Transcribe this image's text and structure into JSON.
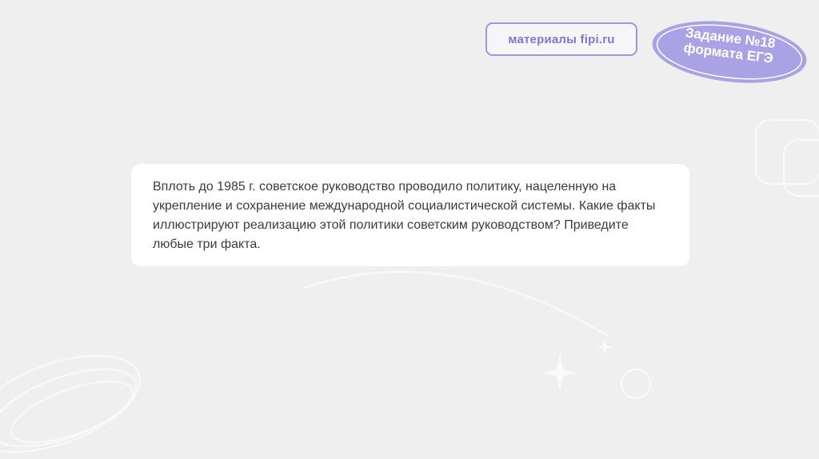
{
  "header": {
    "source_label": "материалы fipi.ru",
    "task_badge_line1": "Задание №18",
    "task_badge_line2": "формата ЕГЭ"
  },
  "question": {
    "text": "Вплоть до 1985 г. советское руководство проводило политику, нацеленную на укрепление и сохранение международной социалистической системы. Какие факты иллюстрируют реализацию этой политики советским руководством? Приведите любые три факта."
  },
  "colors": {
    "background": "#efefef",
    "accent": "#9d97dd",
    "card": "#ffffff",
    "text": "#3b3b3d"
  }
}
